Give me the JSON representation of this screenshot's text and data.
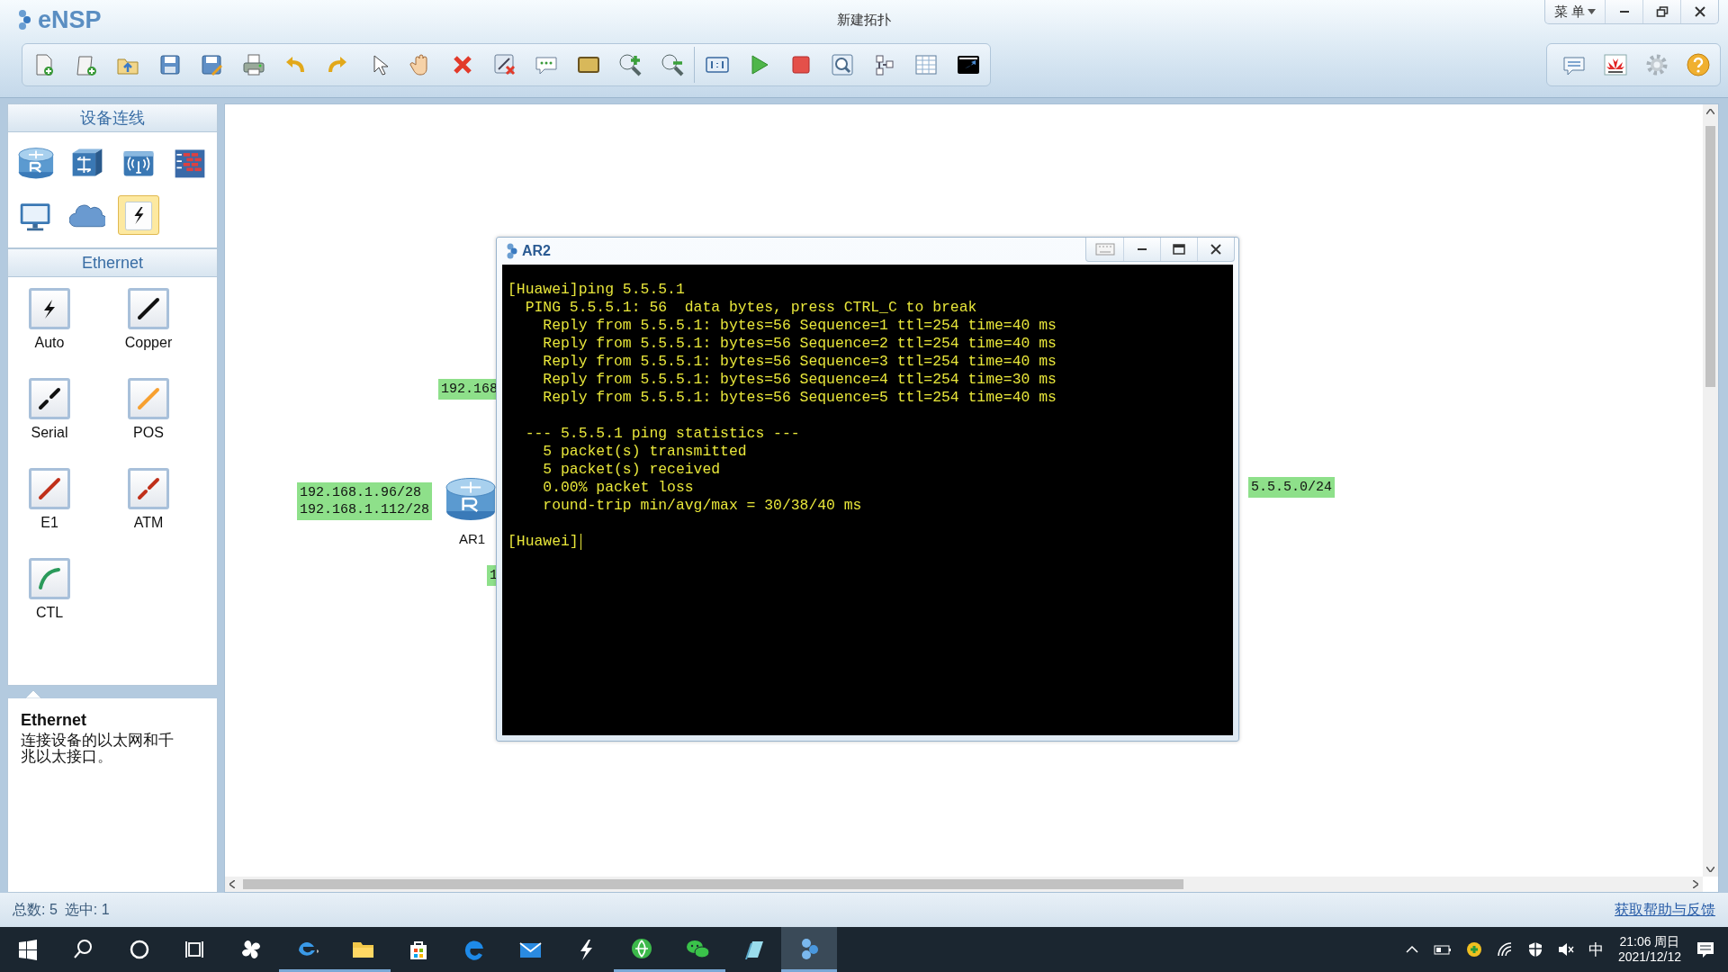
{
  "window": {
    "logo": "eNSP",
    "title": "新建拓扑",
    "menu": "菜 单"
  },
  "sidebar": {
    "devices_header": "设备连线",
    "devices": [
      {
        "selected": false
      },
      {
        "selected": false
      },
      {
        "selected": false
      },
      {
        "selected": false
      },
      {
        "selected": false
      },
      {
        "selected": false
      },
      {
        "selected": true
      }
    ],
    "cables_header": "Ethernet",
    "cables": [
      {
        "label": "Auto"
      },
      {
        "label": "Copper"
      },
      {
        "label": "Serial"
      },
      {
        "label": "POS"
      },
      {
        "label": "E1"
      },
      {
        "label": "ATM"
      },
      {
        "label": "CTL"
      }
    ],
    "info": {
      "title": "Ethernet",
      "text": "连接设备的以太网和千兆以太接口。"
    }
  },
  "canvas": {
    "labels": [
      {
        "lines": [
          "192.168"
        ]
      },
      {
        "lines": [
          "192.168.1.96/28",
          "192.168.1.112/28"
        ]
      },
      {
        "lines": [
          "1"
        ]
      },
      {
        "lines": [
          "5.5.5.0/24"
        ]
      }
    ],
    "devices": [
      {
        "label": "AR1"
      }
    ]
  },
  "terminal": {
    "title": "AR2",
    "blocks": [
      [
        "[Huawei]ping 5.5.5.1",
        "  PING 5.5.5.1: 56  data bytes, press CTRL_C to break",
        "    Reply from 5.5.5.1: bytes=56 Sequence=1 ttl=254 time=40 ms",
        "    Reply from 5.5.5.1: bytes=56 Sequence=2 ttl=254 time=40 ms",
        "    Reply from 5.5.5.1: bytes=56 Sequence=3 ttl=254 time=40 ms",
        "    Reply from 5.5.5.1: bytes=56 Sequence=4 ttl=254 time=30 ms",
        "    Reply from 5.5.5.1: bytes=56 Sequence=5 ttl=254 time=40 ms"
      ],
      [
        "  --- 5.5.5.1 ping statistics ---",
        "    5 packet(s) transmitted",
        "    5 packet(s) received",
        "    0.00% packet loss",
        "    round-trip min/avg/max = 30/38/40 ms"
      ],
      [
        "[Huawei]"
      ]
    ]
  },
  "status_bar": {
    "total": "总数: 5",
    "selected": "选中: 1",
    "help_link": "获取帮助与反馈"
  },
  "taskbar": {
    "ime": "中",
    "time": "21:06 周日",
    "date": "2021/12/12"
  }
}
